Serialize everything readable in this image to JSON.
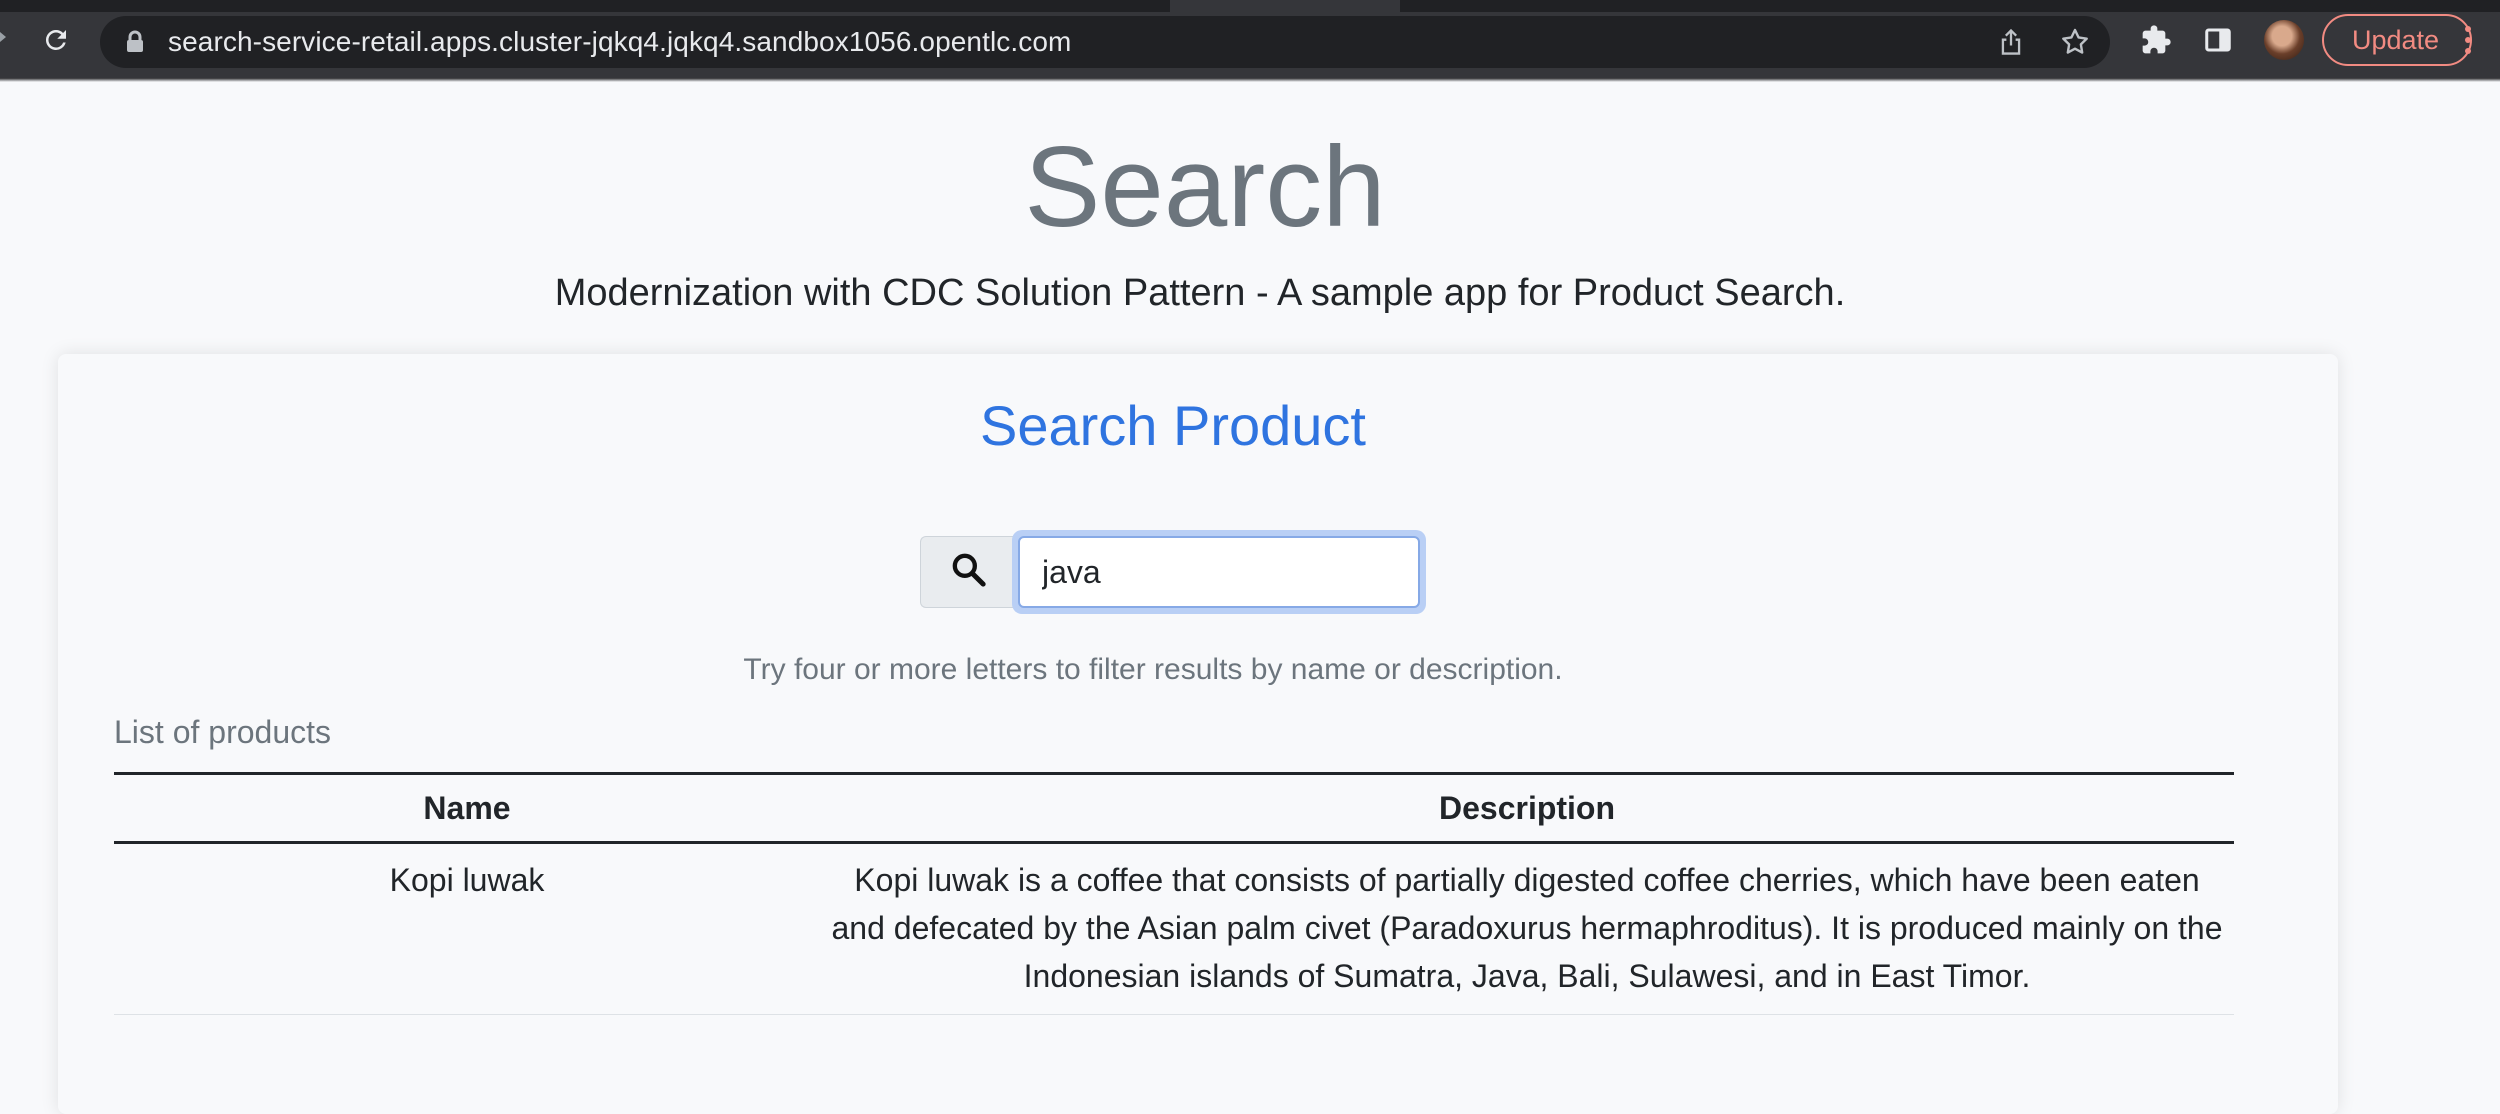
{
  "browser": {
    "url": "search-service-retail.apps.cluster-jqkq4.jqkq4.sandbox1056.opentlc.com",
    "update_label": "Update",
    "icons": [
      "reload-icon",
      "lock-icon",
      "share-icon",
      "star-icon",
      "extensions-icon",
      "side-panel-icon",
      "avatar",
      "more-menu-icon"
    ]
  },
  "header": {
    "title": "Search",
    "subtitle": "Modernization with CDC Solution Pattern - A sample app for Product Search."
  },
  "search": {
    "title": "Search Product",
    "input_value": "java",
    "hint": "Try four or more letters to filter results by name or description."
  },
  "products": {
    "caption": "List of products",
    "columns": [
      "Name",
      "Description"
    ],
    "rows": [
      {
        "name": "Kopi luwak",
        "description": "Kopi luwak is a coffee that consists of partially digested coffee cherries, which have been eaten and defecated by the Asian palm civet (Paradoxurus hermaphroditus). It is produced mainly on the Indonesian islands of Sumatra, Java, Bali, Sulawesi, and in East Timor."
      }
    ]
  },
  "colors": {
    "chrome_bg": "#35363a",
    "omnibox_bg": "#202124",
    "update_accent": "#f28b82",
    "title_gray": "#6c757d",
    "accent_blue": "#2f74e0",
    "page_bg": "#f8f9fb"
  }
}
